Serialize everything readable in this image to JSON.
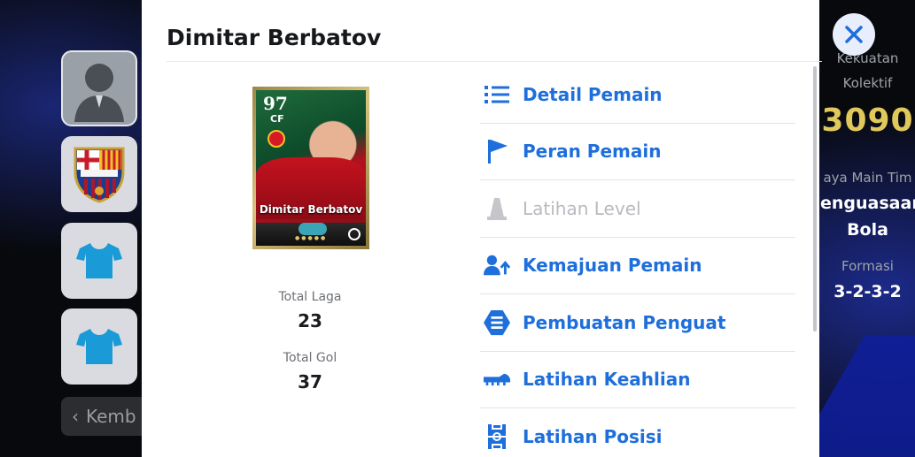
{
  "background": {
    "back_label": "Kemb",
    "right_panel": {
      "collective_strength_label": "Kekuatan Kolektif",
      "collective_strength_value": "3090",
      "team_style_label": "aya Main Tim",
      "team_style_value": "enguasaan Bola",
      "formation_label": "Formasi",
      "formation_value": "3-2-3-2"
    }
  },
  "modal": {
    "title": "Dimitar Berbatov",
    "card": {
      "rating": "97",
      "position": "CF",
      "name": "Dimitar Berbatov"
    },
    "stats": {
      "matches_label": "Total Laga",
      "matches_value": "23",
      "goals_label": "Total Gol",
      "goals_value": "37"
    },
    "menu": [
      {
        "label": "Detail Pemain",
        "icon": "list-icon",
        "enabled": true
      },
      {
        "label": "Peran Pemain",
        "icon": "flag-icon",
        "enabled": true
      },
      {
        "label": "Latihan Level",
        "icon": "cone-icon",
        "enabled": false
      },
      {
        "label": "Kemajuan Pemain",
        "icon": "player-progress-icon",
        "enabled": true
      },
      {
        "label": "Pembuatan Penguat",
        "icon": "booster-icon",
        "enabled": true
      },
      {
        "label": "Latihan Keahlian",
        "icon": "boot-icon",
        "enabled": true
      },
      {
        "label": "Latihan Posisi",
        "icon": "pitch-icon",
        "enabled": true
      }
    ]
  },
  "colors": {
    "accent": "#1e6fdb",
    "disabled": "#b8babf",
    "strength_gold": "#e0c85a"
  }
}
